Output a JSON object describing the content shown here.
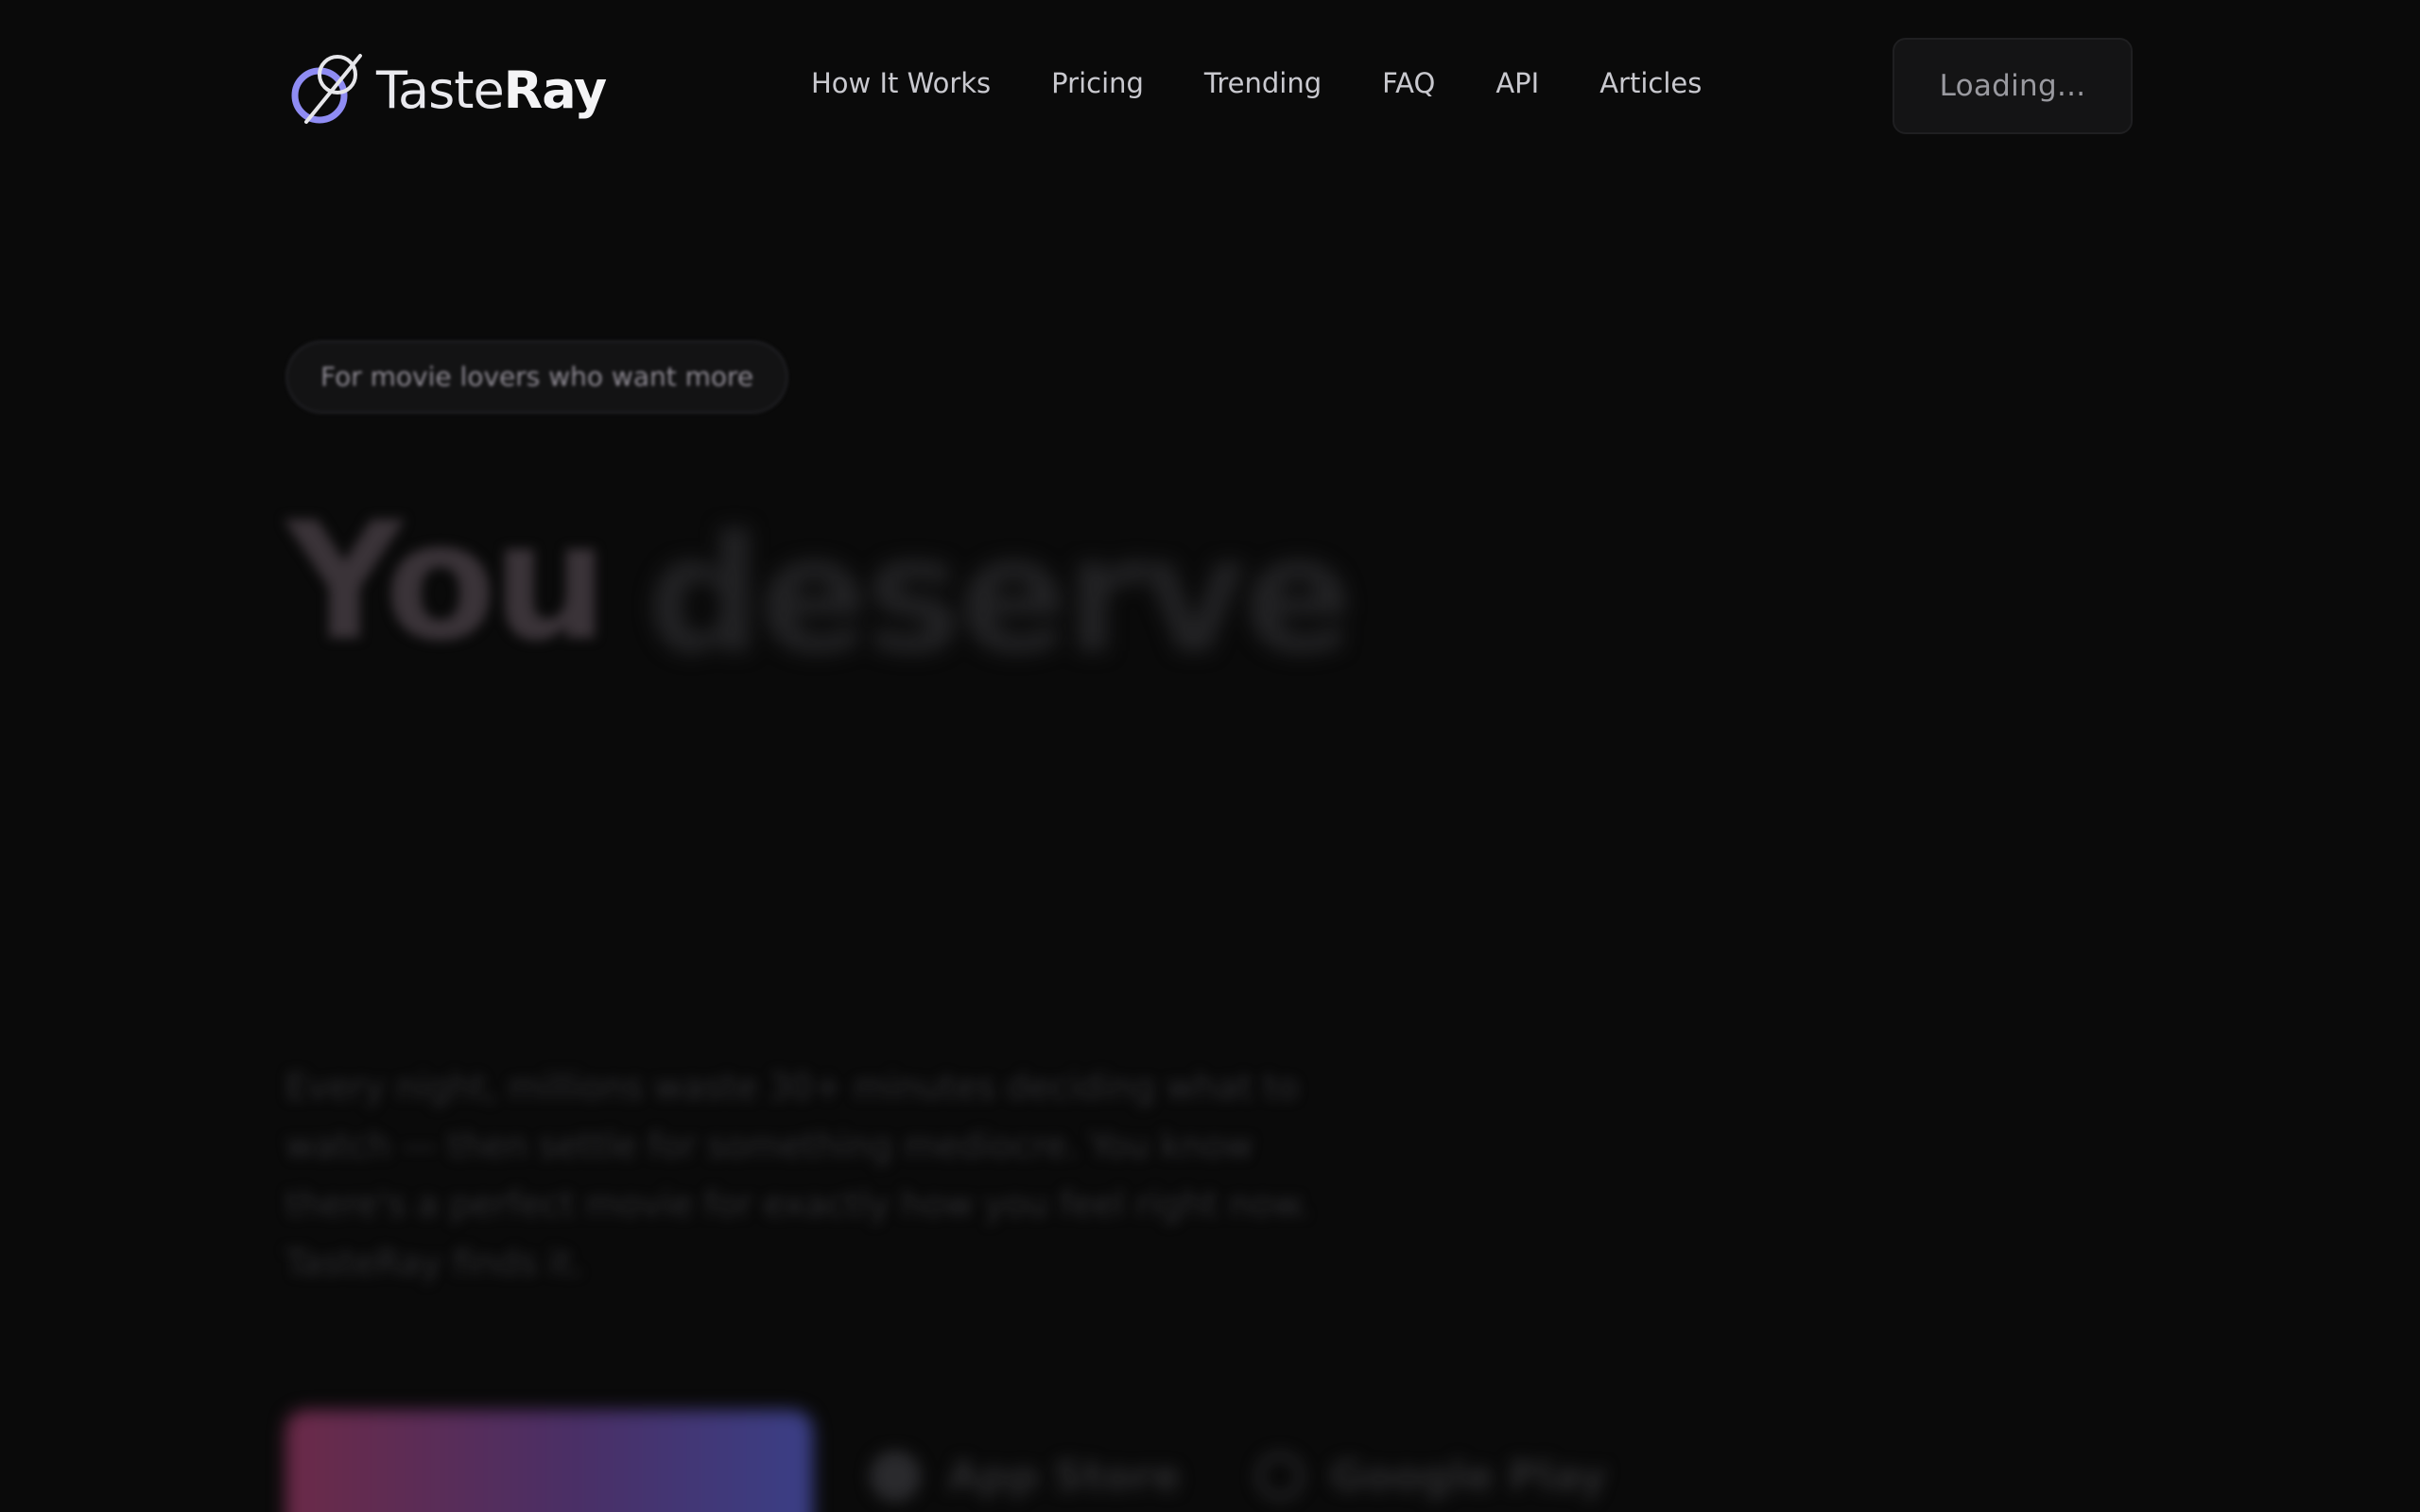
{
  "brand": {
    "name_light": "Taste",
    "name_bold": "Ray",
    "accent": "#8f8cf3"
  },
  "nav": {
    "items": [
      {
        "label": "How It Works"
      },
      {
        "label": "Pricing"
      },
      {
        "label": "Trending"
      },
      {
        "label": "FAQ"
      },
      {
        "label": "API"
      },
      {
        "label": "Articles"
      }
    ]
  },
  "auth_button": {
    "label": "Loading..."
  },
  "hero": {
    "badge": "For movie lovers who want more",
    "headline_word_1": "You",
    "headline_word_2": "deserve",
    "subtext": "Every night, millions waste 30+ minutes deciding what to watch — then settle for something mediocre. You know there's a perfect movie for exactly how you feel right now. TasteRay finds it.",
    "store_1": "App Store",
    "store_2": "Google Play"
  }
}
